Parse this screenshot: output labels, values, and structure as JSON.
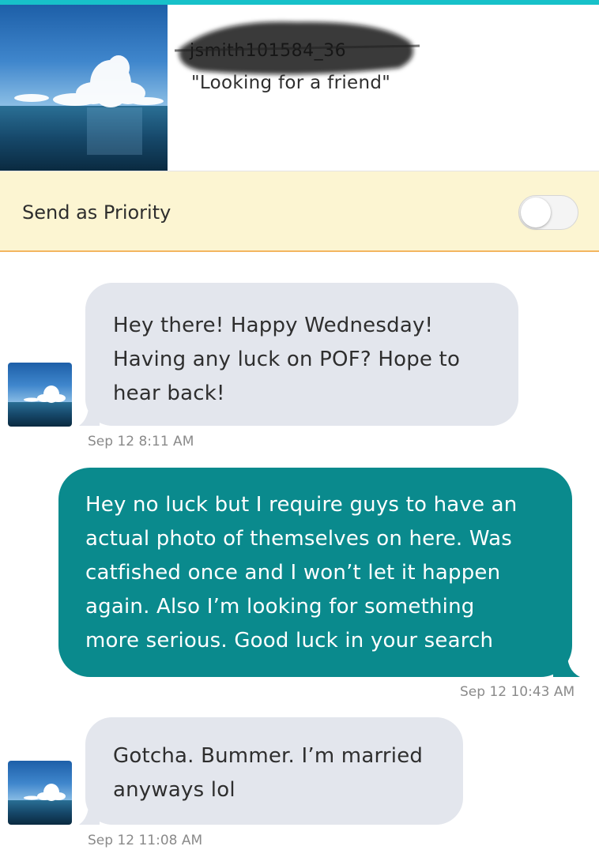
{
  "header": {
    "username": "jsmith101584_36",
    "headline": "\"Looking for a friend\"",
    "photo": "ocean-clouds-photo"
  },
  "priority": {
    "label": "Send as Priority",
    "enabled": false
  },
  "messages": [
    {
      "direction": "incoming",
      "lines": [
        "Hey there! Happy Wednesday!",
        "Having any luck on POF? Hope to",
        "hear back!"
      ],
      "timestamp": "Sep 12 8:11 AM"
    },
    {
      "direction": "outgoing",
      "lines": [
        "Hey no luck but I require guys to have an",
        "actual photo of themselves on here.  Was",
        "catfished once and I won’t let it happen",
        "again.  Also I’m looking for something",
        "more serious.  Good luck in your search"
      ],
      "timestamp": "Sep 12 10:43 AM"
    },
    {
      "direction": "incoming",
      "lines": [
        "Gotcha. Bummer. I’m married",
        "anyways lol"
      ],
      "timestamp": "Sep 12 11:08 AM"
    }
  ],
  "colors": {
    "accent_bar": "#17c1c9",
    "incoming_bubble": "#e3e6ed",
    "outgoing_bubble": "#0a8a8d",
    "priority_bg": "#fcf5d2",
    "priority_border": "#f3b661"
  }
}
